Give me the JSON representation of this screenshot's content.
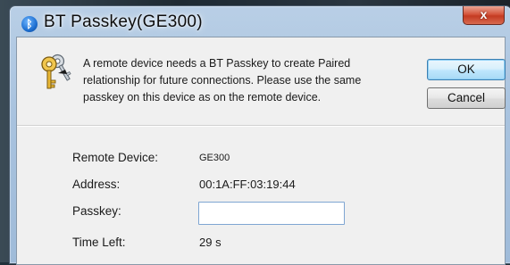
{
  "window": {
    "title": "BT Passkey(GE300)",
    "close_label": "x"
  },
  "message": "A remote device needs a BT Passkey to create Paired relationship for future connections. Please use the same passkey on this device as on the remote device.",
  "buttons": {
    "ok_label": "OK",
    "cancel_label": "Cancel"
  },
  "fields": {
    "remote_device_label": "Remote Device:",
    "remote_device_value": "GE300",
    "address_label": "Address:",
    "address_value": "00:1A:FF:03:19:44",
    "passkey_label": "Passkey:",
    "passkey_value": "",
    "time_left_label": "Time Left:",
    "time_left_value": "29 s"
  },
  "icons": {
    "title": "bluetooth-icon",
    "message": "keys-icon",
    "close": "close-icon"
  },
  "colors": {
    "title_bar": "#a9c3df",
    "close_button": "#c43b22",
    "client_bg": "#f0f0f0",
    "ok_border": "#3c7fb1"
  }
}
